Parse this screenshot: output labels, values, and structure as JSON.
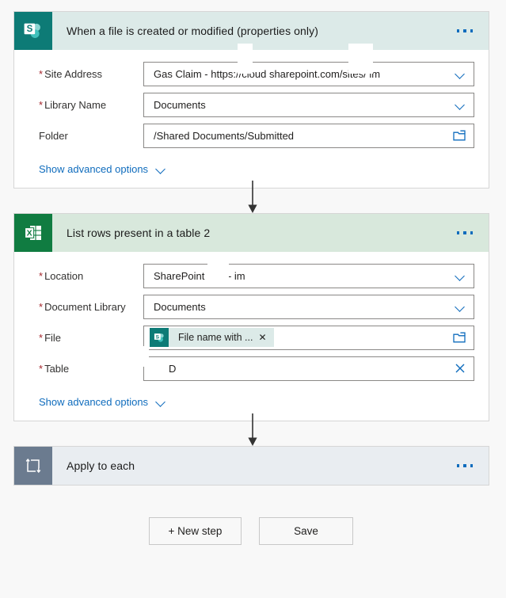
{
  "page": {
    "background": "#f8f8f8"
  },
  "cards": [
    {
      "name": "when-a-file-is-created-or-modified",
      "title": "When a file is created or modified (properties only)",
      "icon": "sharepoint-icon",
      "icon_bg": "#0d7b76",
      "header_bg": "#dceae8",
      "more_label": "•••",
      "fields": [
        {
          "label": "Site Address",
          "required": true,
          "value": "Gas Claim - https://cloud         sharepoint.com/sites/          im",
          "control": "dropdown-chevron"
        },
        {
          "label": "Library Name",
          "required": true,
          "value": "Documents",
          "control": "dropdown-chevron"
        },
        {
          "label": "Folder",
          "required": false,
          "value": "/Shared Documents/Submitted",
          "control": "folder-picker"
        }
      ],
      "advanced_label": "Show advanced options"
    },
    {
      "name": "list-rows-present-in-a-table-2",
      "title": "List rows present in a table 2",
      "icon": "excel-icon",
      "icon_bg": "#107c41",
      "header_bg": "#d8e8dc",
      "more_label": "•••",
      "fields": [
        {
          "label": "Location",
          "required": true,
          "value": "SharePoint Site -        im",
          "control": "dropdown-chevron"
        },
        {
          "label": "Document Library",
          "required": true,
          "value": "Documents",
          "control": "dropdown-chevron"
        },
        {
          "label": "File",
          "required": true,
          "value": "",
          "control": "folder-picker",
          "chip": {
            "label": "File name with ...",
            "remove": "✕",
            "icon": "sharepoint-icon"
          }
        },
        {
          "label": "Table",
          "required": true,
          "value": "D",
          "control": "clear-x"
        }
      ],
      "advanced_label": "Show advanced options"
    },
    {
      "name": "apply-to-each",
      "title": "Apply to each",
      "icon": "loop-icon",
      "icon_bg": "#6b7b8f",
      "header_bg": "#e9edf1",
      "more_label": "•••",
      "fields": [],
      "advanced_label": ""
    }
  ],
  "footer": {
    "new_step_label": "+ New step",
    "save_label": "Save"
  },
  "colors": {
    "accent_blue": "#0f6cbd",
    "required_red": "#a4262c",
    "sharepoint_teal": "#0d7b76",
    "excel_green": "#107c41",
    "loop_slate": "#6b7b8f",
    "page_bg": "#f8f8f8"
  }
}
